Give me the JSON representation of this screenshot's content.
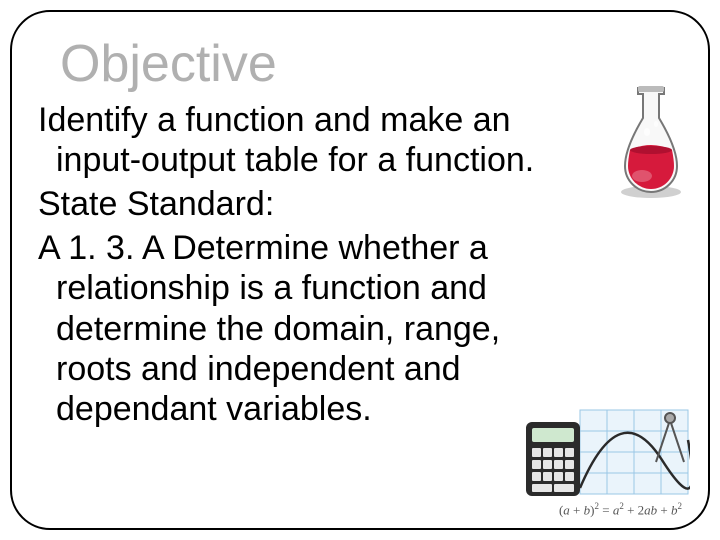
{
  "title": "Objective",
  "body": {
    "line1": "Identify a function and make an",
    "line2": "input-output table for a function.",
    "line3": "State Standard:",
    "line4": "A 1. 3. A Determine whether a",
    "line5": "relationship is a function and",
    "line6": "determine the domain, range,",
    "line7": "roots and independent and",
    "line8": "dependant variables."
  },
  "decor": {
    "flask": "flask-icon",
    "mathpic": "calculator-graph-icon",
    "formula_html": "(a + b)² = a² + 2ab + b²"
  }
}
